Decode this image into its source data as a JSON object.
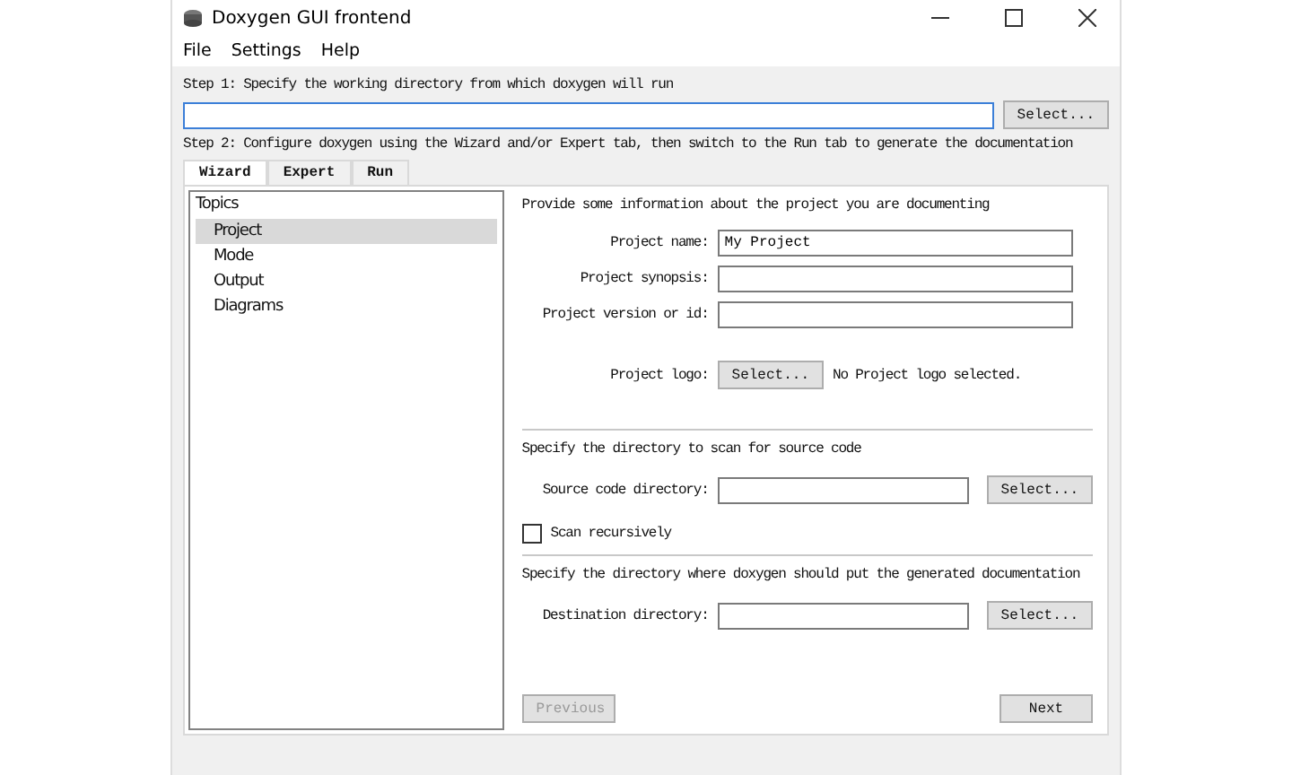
{
  "window": {
    "title": "Doxygen GUI frontend"
  },
  "menu": [
    "File",
    "Settings",
    "Help"
  ],
  "step1": {
    "label": "Step 1: Specify the working directory from which doxygen will run",
    "button": "Select..."
  },
  "step2": {
    "label": "Step 2: Configure doxygen using the Wizard and/or Expert tab, then switch to the Run tab to generate the documentation"
  },
  "tabs": [
    {
      "label": "Wizard",
      "selected": true
    },
    {
      "label": "Expert",
      "selected": false
    },
    {
      "label": "Run",
      "selected": false
    }
  ],
  "topics": {
    "title": "Topics",
    "items": [
      {
        "label": "Project",
        "selected": true
      },
      {
        "label": "Mode",
        "selected": false
      },
      {
        "label": "Output",
        "selected": false
      },
      {
        "label": "Diagrams",
        "selected": false
      }
    ]
  },
  "project": {
    "intro": "Provide some information about the project you are documenting",
    "fields": [
      {
        "label": "Project name:",
        "value": "My Project"
      },
      {
        "label": "Project synopsis:"
      },
      {
        "label": "Project version or id:"
      }
    ],
    "logo": {
      "label": "Project logo:",
      "button": "Select...",
      "status": "No Project logo selected."
    }
  },
  "source": {
    "intro": "Specify the directory to scan for source code",
    "label": "Source code directory:",
    "button": "Select...",
    "recursive": {
      "label": "Scan recursively",
      "checked": false
    }
  },
  "destination": {
    "intro": "Specify the directory where doxygen should put the generated documentation",
    "label": "Destination directory:",
    "button": "Select..."
  },
  "nav": [
    {
      "label": "Previous",
      "disabled": true
    },
    {
      "label": "Next",
      "disabled": false
    }
  ]
}
